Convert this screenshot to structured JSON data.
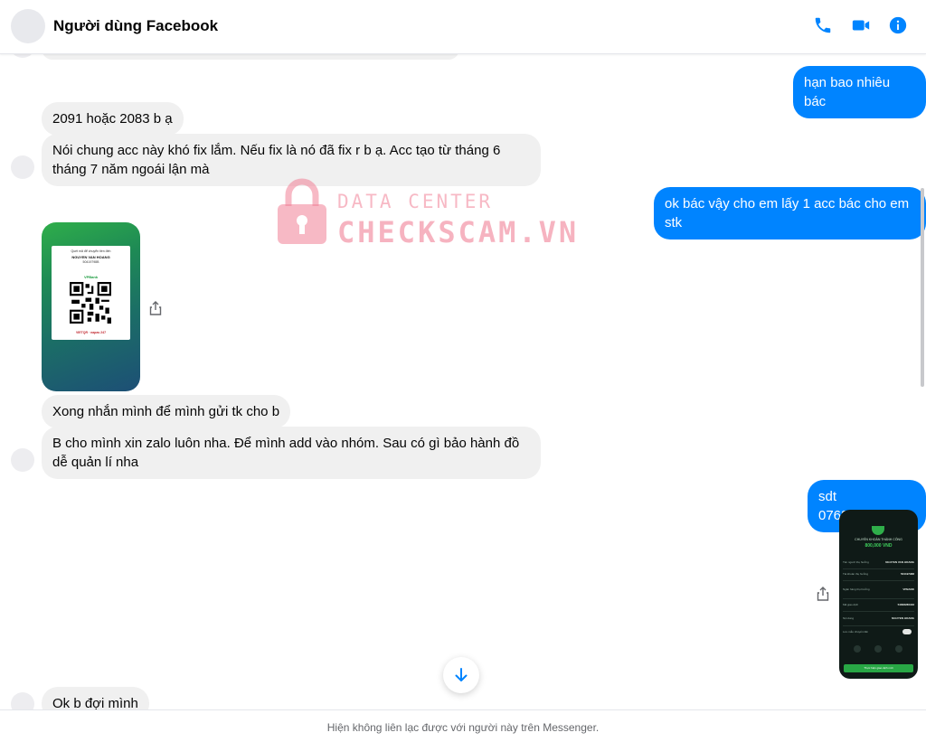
{
  "header": {
    "contact_name": "Người dùng Facebook",
    "icons": [
      "phone-icon",
      "video-call-icon",
      "info-icon"
    ],
    "accent_color": "#0084ff"
  },
  "messages": [
    {
      "side": "incoming",
      "text": "2091 hoặc 2083 b ạ"
    },
    {
      "side": "incoming",
      "text": "Nói chung acc này khó fix lắm. Nếu fix là nó đã fix r b ạ. Acc tạo từ tháng 6 tháng 7 năm ngoái lận mà"
    },
    {
      "side": "outgoing",
      "text": "hạn bao nhiêu bác"
    },
    {
      "side": "outgoing",
      "text": "ok bác vậy cho em lấy 1 acc bác cho em stk"
    },
    {
      "side": "incoming",
      "text": "Xong nhắn mình để mình gửi tk cho b"
    },
    {
      "side": "incoming",
      "text": "B cho mình xin zalo luôn nha. Để mình add vào nhóm. Sau có gì bảo hành đồ dễ quản lí nha"
    },
    {
      "side": "outgoing",
      "text": "sdt 0768866094"
    },
    {
      "side": "incoming",
      "text": "Ok b đợi mình"
    }
  ],
  "qr_image": {
    "line1": "Quét mã để chuyển tiền đến",
    "name": "NGUYEN VAN HOANG",
    "account": "50419798B",
    "bank": "VPBank",
    "footer": "VIETQR · napas 247"
  },
  "receipt_image": {
    "status": "CHUYỂN KHOẢN THÀNH CÔNG",
    "amount": "800,000 VND",
    "rows": [
      {
        "label": "Tên người thụ hưởng",
        "value": "NGUYEN VAN HOANG"
      },
      {
        "label": "Tài khoản thụ hưởng",
        "value": "504197988"
      },
      {
        "label": "Ngân hàng thụ hưởng",
        "value": "VPBANK"
      },
      {
        "label": "Mã giao dịch",
        "value": "54808280183"
      },
      {
        "label": "Nội dung",
        "value": "NGUYEN HOANG"
      },
      {
        "label": "Lưu mẫu chuyển tiền",
        "value": ""
      }
    ],
    "button": "Thực hiện giao dịch mới"
  },
  "watermark": {
    "line1": "DATA CENTER",
    "line2": "CHECKSCAM.VN"
  },
  "footer": {
    "notice": "Hiện không liên lạc được với người này trên Messenger."
  }
}
